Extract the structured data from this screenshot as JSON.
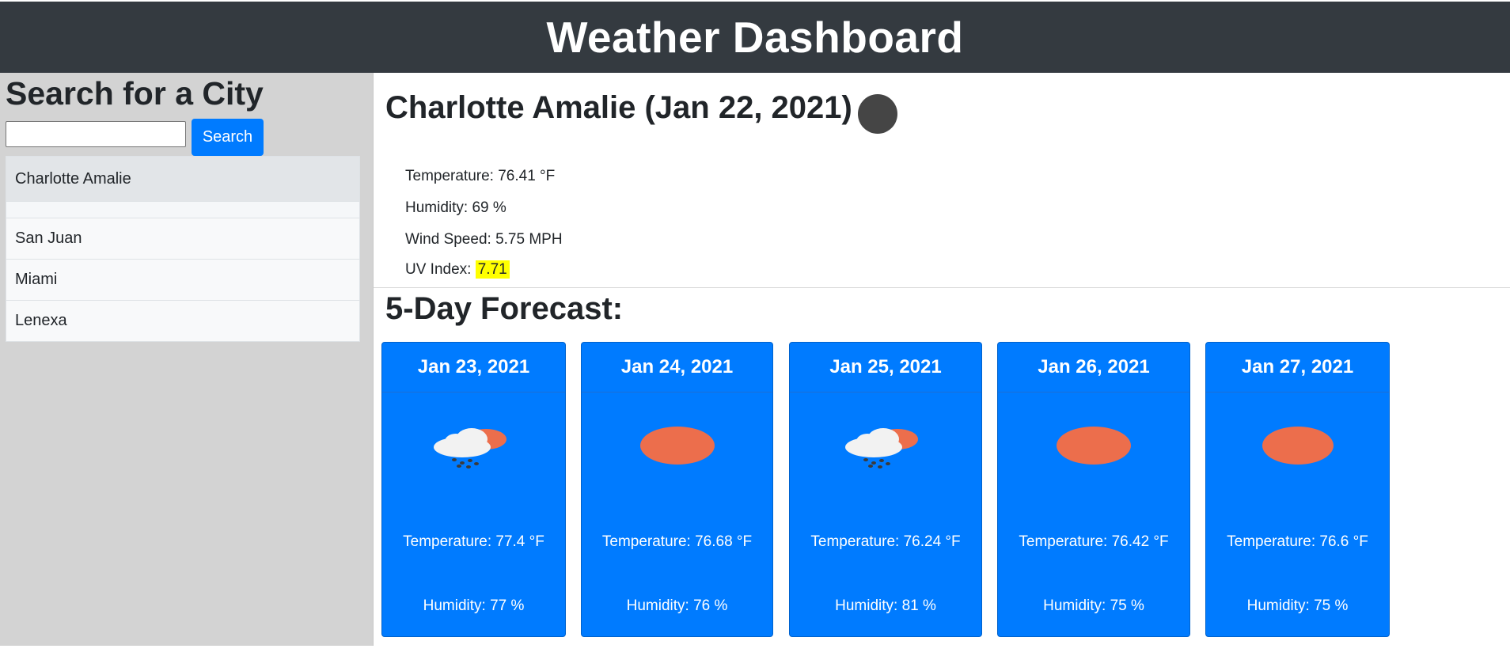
{
  "header": {
    "title": "Weather Dashboard"
  },
  "sidebar": {
    "heading": "Search for a City",
    "search": {
      "value": "",
      "placeholder": ""
    },
    "search_button": "Search",
    "history": [
      {
        "label": "Charlotte Amalie",
        "active": true
      },
      {
        "label": ""
      },
      {
        "label": "San Juan"
      },
      {
        "label": "Miami"
      },
      {
        "label": "Lenexa"
      }
    ]
  },
  "current": {
    "title": "Charlotte Amalie (Jan 22, 2021)",
    "icon": "weather-icon",
    "temperature": "Temperature: 76.41 °F",
    "humidity": "Humidity: 69 %",
    "wind": "Wind Speed: 5.75 MPH",
    "uv_label": "UV Index: ",
    "uv_value": "7.71",
    "uv_color": "#ffff00"
  },
  "forecast": {
    "title": "5-Day Forecast:",
    "days": [
      {
        "date": "Jan 23, 2021",
        "icon": "rain-cloud-sun-icon",
        "temp": "Temperature: 77.4 °F",
        "humidity": "Humidity: 77 %"
      },
      {
        "date": "Jan 24, 2021",
        "icon": "sun-icon",
        "temp": "Temperature: 76.68 °F",
        "humidity": "Humidity: 76 %"
      },
      {
        "date": "Jan 25, 2021",
        "icon": "rain-cloud-sun-icon",
        "temp": "Temperature: 76.24 °F",
        "humidity": "Humidity: 81 %"
      },
      {
        "date": "Jan 26, 2021",
        "icon": "sun-icon",
        "temp": "Temperature: 76.42 °F",
        "humidity": "Humidity: 75 %"
      },
      {
        "date": "Jan 27, 2021",
        "icon": "sun-icon",
        "temp": "Temperature: 76.6 °F",
        "humidity": "Humidity: 75 %"
      }
    ]
  },
  "colors": {
    "header_bg": "#343a40",
    "accent": "#007bff",
    "sun": "#ec6e4c"
  }
}
